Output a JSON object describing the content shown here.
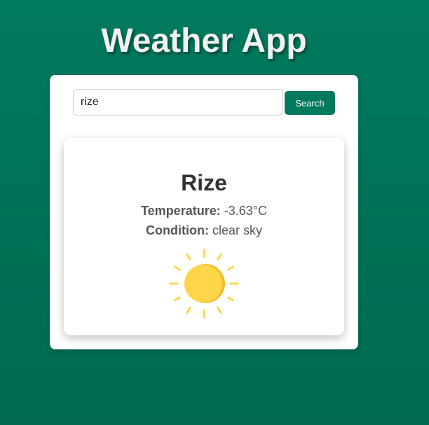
{
  "header": {
    "title": "Weather App"
  },
  "search": {
    "value": "rize",
    "button_label": "Search"
  },
  "weather": {
    "city": "Rize",
    "temperature_label": "Temperature:",
    "temperature_value": "-3.63°C",
    "condition_label": "Condition:",
    "condition_value": "clear sky",
    "icon": "sun-icon"
  },
  "colors": {
    "background": "#007a5e",
    "accent": "#007a5e",
    "sun": "#ffd54a",
    "sun_shade": "#f9b829"
  }
}
